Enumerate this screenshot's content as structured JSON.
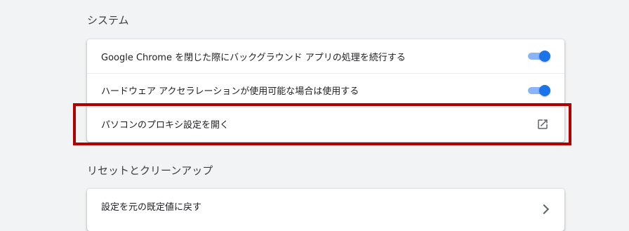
{
  "system": {
    "title": "システム",
    "rows": [
      {
        "label": "Google Chrome を閉じた際にバックグラウンド アプリの処理を続行する",
        "toggle_on": true
      },
      {
        "label": "ハードウェア アクセラレーションが使用可能な場合は使用する",
        "toggle_on": true
      },
      {
        "label": "パソコンのプロキシ設定を開く",
        "icon": "external-link-icon"
      }
    ]
  },
  "reset": {
    "title": "リセットとクリーンアップ",
    "rows": [
      {
        "label": "設定を元の既定値に戻す",
        "icon": "chevron-right-icon"
      }
    ]
  },
  "colors": {
    "accent": "#1a73e8",
    "toggle_track": "#8ab4f8",
    "highlight_border": "#b00000",
    "background": "#f1f3f4"
  }
}
